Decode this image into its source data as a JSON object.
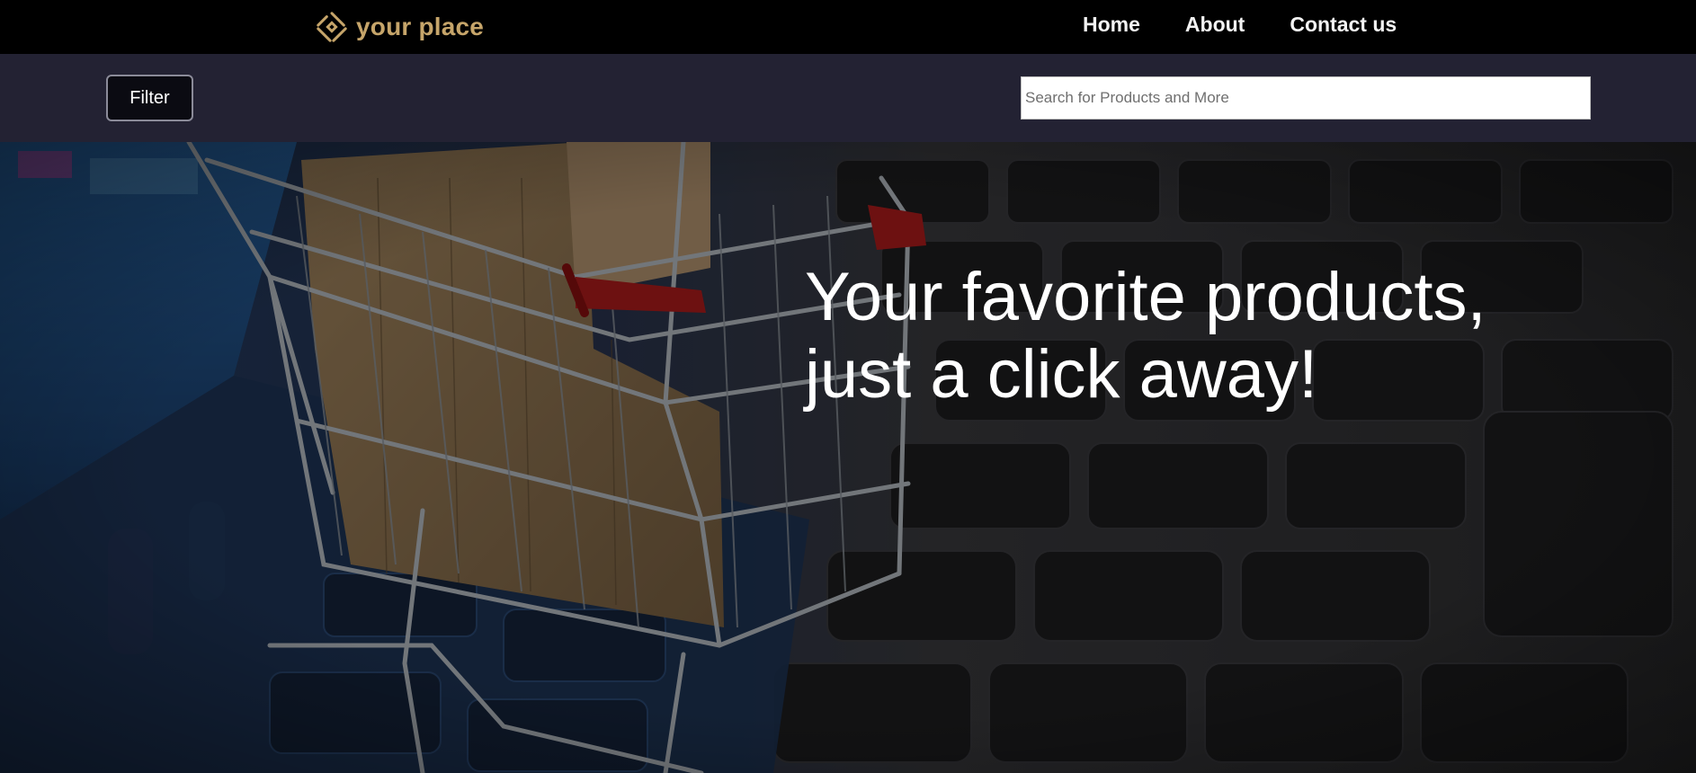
{
  "brand": {
    "name": "your place",
    "logo_icon": "diamond-logo-icon",
    "color": "#c6a56a"
  },
  "nav": {
    "items": [
      {
        "label": "Home"
      },
      {
        "label": "About"
      },
      {
        "label": "Contact us"
      }
    ]
  },
  "toolbar": {
    "filter_label": "Filter",
    "search_placeholder": "Search for Products and More",
    "search_value": ""
  },
  "hero": {
    "title_line1": "Your favorite products,",
    "title_line2": "just a click away!",
    "background": "shopping-cart-on-laptop-keyboard-photo"
  },
  "colors": {
    "navbar_bg": "#000000",
    "subbar_bg": "#232233",
    "text_primary": "#ffffff"
  }
}
